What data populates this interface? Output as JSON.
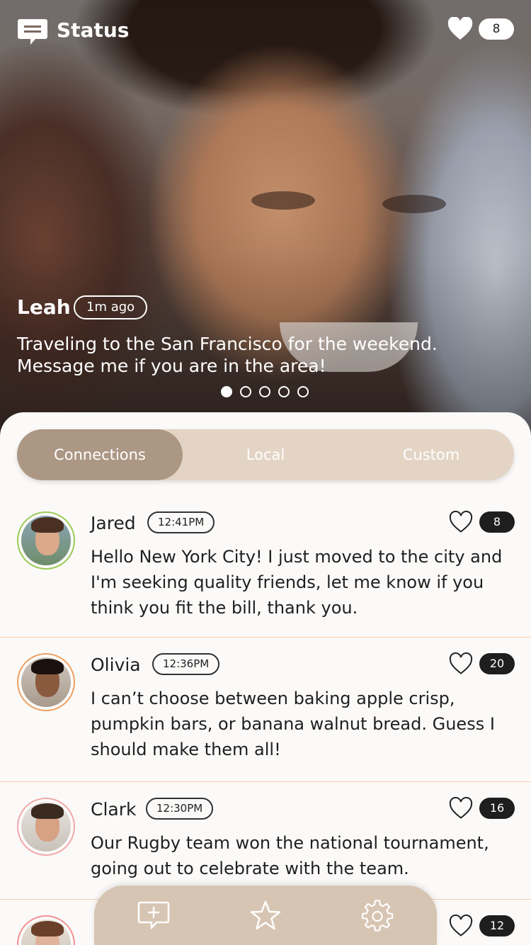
{
  "header": {
    "title": "Status",
    "likes_count": "8"
  },
  "featured": {
    "name": "Leah",
    "time": "1m ago",
    "message_line1": "Traveling to the San Francisco for the weekend.",
    "message_line2": "Message me if you are in the area!",
    "page_count": 5,
    "active_page": 1
  },
  "tabs": [
    {
      "label": "Connections",
      "active": true
    },
    {
      "label": "Local",
      "active": false
    },
    {
      "label": "Custom",
      "active": false
    }
  ],
  "feed": [
    {
      "name": "Jared",
      "time": "12:41PM",
      "likes": "8",
      "text": "Hello New York City!  I just moved to the city and I'm seeking quality friends, let me know if you think you fit the bill, thank you."
    },
    {
      "name": "Olivia",
      "time": "12:36PM",
      "likes": "20",
      "text": "I can’t choose between baking apple crisp, pumpkin bars, or banana walnut bread. Guess I should make them all!"
    },
    {
      "name": "Clark",
      "time": "12:30PM",
      "likes": "16",
      "text": "Our Rugby team won the national tournament, going out to celebrate with the team."
    },
    {
      "name": "",
      "time": "",
      "likes": "12",
      "text": ""
    }
  ],
  "bottom_nav": [
    {
      "icon": "compose-message-icon"
    },
    {
      "icon": "star-icon"
    },
    {
      "icon": "settings-gear-icon"
    }
  ],
  "colors": {
    "accent": "#ac9784",
    "segment_bg": "#e3d4c5",
    "nav_bg": "#d7c5b3",
    "divider": "#f3cbb0",
    "avatar_ring_green": "#9acb55",
    "avatar_ring_orange": "#f0a060",
    "avatar_ring_pink": "#f2a8a8"
  }
}
